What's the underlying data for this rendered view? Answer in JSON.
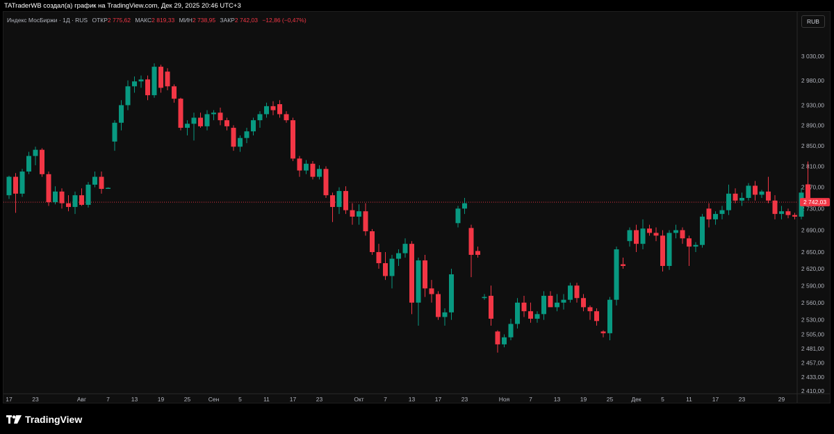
{
  "credit": "TATraderWB создал(а) график на TradingView.com, Дек 29, 2025 20:46 UTC+3",
  "legend": {
    "symbol": "Индекс МосБиржи · 1Д · RUS",
    "open_label": "ОТКР",
    "open": "2 775,62",
    "high_label": "МАКС",
    "high": "2 819,33",
    "low_label": "МИН",
    "low": "2 738,95",
    "close_label": "ЗАКР",
    "close": "2 742,03",
    "change": "−12,86 (−0,47%)"
  },
  "currency_button": "RUB",
  "brand": "TradingView",
  "colors": {
    "up": "#089981",
    "down": "#f23645",
    "background": "#0f0f0f",
    "text": "#d1d4dc"
  },
  "chart_data": {
    "type": "candlestick",
    "y_scale": "log",
    "ylim": [
      2410,
      3060
    ],
    "y_ticks": [
      {
        "value": 3030,
        "label": "3 030,00"
      },
      {
        "value": 2980,
        "label": "2 980,00"
      },
      {
        "value": 2930,
        "label": "2 930,00"
      },
      {
        "value": 2890,
        "label": "2 890,00"
      },
      {
        "value": 2850,
        "label": "2 850,00"
      },
      {
        "value": 2810,
        "label": "2 810,00"
      },
      {
        "value": 2770,
        "label": "2 770,00"
      },
      {
        "value": 2730,
        "label": "2 730,00"
      },
      {
        "value": 2690,
        "label": "2 690,00"
      },
      {
        "value": 2650,
        "label": "2 650,00"
      },
      {
        "value": 2620,
        "label": "2 620,00"
      },
      {
        "value": 2590,
        "label": "2 590,00"
      },
      {
        "value": 2560,
        "label": "2 560,00"
      },
      {
        "value": 2530,
        "label": "2 530,00"
      },
      {
        "value": 2505,
        "label": "2 505,00"
      },
      {
        "value": 2481,
        "label": "2 481,00"
      },
      {
        "value": 2457,
        "label": "2 457,00"
      },
      {
        "value": 2433,
        "label": "2 433,00"
      },
      {
        "value": 2410,
        "label": "2 410,00"
      }
    ],
    "x_ticks": [
      {
        "index": 0,
        "label": "17"
      },
      {
        "index": 4,
        "label": "23"
      },
      {
        "index": 11,
        "label": "Авг"
      },
      {
        "index": 15,
        "label": "7"
      },
      {
        "index": 19,
        "label": "13"
      },
      {
        "index": 23,
        "label": "19"
      },
      {
        "index": 27,
        "label": "25"
      },
      {
        "index": 31,
        "label": "Сен"
      },
      {
        "index": 35,
        "label": "5"
      },
      {
        "index": 39,
        "label": "11"
      },
      {
        "index": 43,
        "label": "17"
      },
      {
        "index": 47,
        "label": "23"
      },
      {
        "index": 53,
        "label": "Окт"
      },
      {
        "index": 57,
        "label": "7"
      },
      {
        "index": 61,
        "label": "13"
      },
      {
        "index": 65,
        "label": "17"
      },
      {
        "index": 69,
        "label": "23"
      },
      {
        "index": 75,
        "label": "Ноя"
      },
      {
        "index": 79,
        "label": "7"
      },
      {
        "index": 83,
        "label": "13"
      },
      {
        "index": 87,
        "label": "19"
      },
      {
        "index": 91,
        "label": "25"
      },
      {
        "index": 95,
        "label": "Дек"
      },
      {
        "index": 99,
        "label": "5"
      },
      {
        "index": 103,
        "label": "11"
      },
      {
        "index": 107,
        "label": "17"
      },
      {
        "index": 111,
        "label": "23"
      },
      {
        "index": 117,
        "label": "29"
      }
    ],
    "last_price": {
      "value": 2742.03,
      "label": "2 742,03"
    },
    "candles": [
      {
        "o": 2755,
        "h": 2792,
        "l": 2748,
        "c": 2790
      },
      {
        "o": 2790,
        "h": 2797,
        "l": 2722,
        "c": 2758
      },
      {
        "o": 2758,
        "h": 2805,
        "l": 2752,
        "c": 2800
      },
      {
        "o": 2800,
        "h": 2838,
        "l": 2795,
        "c": 2830
      },
      {
        "o": 2830,
        "h": 2848,
        "l": 2812,
        "c": 2842
      },
      {
        "o": 2842,
        "h": 2845,
        "l": 2790,
        "c": 2795
      },
      {
        "o": 2795,
        "h": 2800,
        "l": 2735,
        "c": 2742
      },
      {
        "o": 2742,
        "h": 2772,
        "l": 2738,
        "c": 2762
      },
      {
        "o": 2762,
        "h": 2768,
        "l": 2730,
        "c": 2740
      },
      {
        "o": 2740,
        "h": 2755,
        "l": 2725,
        "c": 2733
      },
      {
        "o": 2733,
        "h": 2762,
        "l": 2720,
        "c": 2755
      },
      {
        "o": 2755,
        "h": 2768,
        "l": 2735,
        "c": 2737
      },
      {
        "o": 2737,
        "h": 2780,
        "l": 2732,
        "c": 2775
      },
      {
        "o": 2775,
        "h": 2800,
        "l": 2770,
        "c": 2790
      },
      {
        "o": 2790,
        "h": 2800,
        "l": 2758,
        "c": 2767
      },
      {
        "o": 2767,
        "h": 2770,
        "l": 2767,
        "c": 2769
      },
      {
        "o": 2858,
        "h": 2900,
        "l": 2840,
        "c": 2895
      },
      {
        "o": 2895,
        "h": 2940,
        "l": 2880,
        "c": 2930
      },
      {
        "o": 2930,
        "h": 2980,
        "l": 2920,
        "c": 2968
      },
      {
        "o": 2968,
        "h": 2988,
        "l": 2955,
        "c": 2978
      },
      {
        "o": 2978,
        "h": 2990,
        "l": 2965,
        "c": 2982
      },
      {
        "o": 2982,
        "h": 2990,
        "l": 2940,
        "c": 2950
      },
      {
        "o": 2950,
        "h": 3015,
        "l": 2945,
        "c": 3008
      },
      {
        "o": 3008,
        "h": 3012,
        "l": 2955,
        "c": 2965
      },
      {
        "o": 2998,
        "h": 3005,
        "l": 2960,
        "c": 2968
      },
      {
        "o": 2968,
        "h": 2972,
        "l": 2935,
        "c": 2943
      },
      {
        "o": 2943,
        "h": 2945,
        "l": 2880,
        "c": 2885
      },
      {
        "o": 2885,
        "h": 2900,
        "l": 2870,
        "c": 2893
      },
      {
        "o": 2893,
        "h": 2915,
        "l": 2860,
        "c": 2905
      },
      {
        "o": 2905,
        "h": 2915,
        "l": 2885,
        "c": 2888
      },
      {
        "o": 2888,
        "h": 2920,
        "l": 2880,
        "c": 2912
      },
      {
        "o": 2912,
        "h": 2920,
        "l": 2900,
        "c": 2915
      },
      {
        "o": 2915,
        "h": 2925,
        "l": 2890,
        "c": 2900
      },
      {
        "o": 2900,
        "h": 2905,
        "l": 2880,
        "c": 2888
      },
      {
        "o": 2885,
        "h": 2890,
        "l": 2840,
        "c": 2848
      },
      {
        "o": 2848,
        "h": 2870,
        "l": 2838,
        "c": 2865
      },
      {
        "o": 2865,
        "h": 2885,
        "l": 2855,
        "c": 2878
      },
      {
        "o": 2878,
        "h": 2905,
        "l": 2870,
        "c": 2900
      },
      {
        "o": 2900,
        "h": 2918,
        "l": 2885,
        "c": 2912
      },
      {
        "o": 2912,
        "h": 2935,
        "l": 2905,
        "c": 2928
      },
      {
        "o": 2928,
        "h": 2938,
        "l": 2910,
        "c": 2920
      },
      {
        "o": 2932,
        "h": 2940,
        "l": 2905,
        "c": 2912
      },
      {
        "o": 2912,
        "h": 2918,
        "l": 2895,
        "c": 2900
      },
      {
        "o": 2900,
        "h": 2905,
        "l": 2820,
        "c": 2825
      },
      {
        "o": 2825,
        "h": 2830,
        "l": 2790,
        "c": 2802
      },
      {
        "o": 2802,
        "h": 2822,
        "l": 2795,
        "c": 2815
      },
      {
        "o": 2815,
        "h": 2820,
        "l": 2785,
        "c": 2790
      },
      {
        "o": 2790,
        "h": 2812,
        "l": 2785,
        "c": 2805
      },
      {
        "o": 2805,
        "h": 2810,
        "l": 2750,
        "c": 2755
      },
      {
        "o": 2755,
        "h": 2760,
        "l": 2705,
        "c": 2733
      },
      {
        "o": 2733,
        "h": 2770,
        "l": 2720,
        "c": 2763
      },
      {
        "o": 2763,
        "h": 2772,
        "l": 2720,
        "c": 2727
      },
      {
        "o": 2727,
        "h": 2740,
        "l": 2700,
        "c": 2715
      },
      {
        "o": 2715,
        "h": 2738,
        "l": 2700,
        "c": 2725
      },
      {
        "o": 2725,
        "h": 2740,
        "l": 2680,
        "c": 2688
      },
      {
        "o": 2688,
        "h": 2692,
        "l": 2645,
        "c": 2650
      },
      {
        "o": 2650,
        "h": 2665,
        "l": 2620,
        "c": 2630
      },
      {
        "o": 2630,
        "h": 2650,
        "l": 2600,
        "c": 2607
      },
      {
        "o": 2607,
        "h": 2645,
        "l": 2585,
        "c": 2638
      },
      {
        "o": 2638,
        "h": 2655,
        "l": 2625,
        "c": 2648
      },
      {
        "o": 2648,
        "h": 2675,
        "l": 2640,
        "c": 2665
      },
      {
        "o": 2665,
        "h": 2670,
        "l": 2540,
        "c": 2560
      },
      {
        "o": 2560,
        "h": 2640,
        "l": 2520,
        "c": 2635
      },
      {
        "o": 2635,
        "h": 2645,
        "l": 2570,
        "c": 2585
      },
      {
        "o": 2585,
        "h": 2600,
        "l": 2560,
        "c": 2575
      },
      {
        "o": 2575,
        "h": 2580,
        "l": 2530,
        "c": 2535
      },
      {
        "o": 2535,
        "h": 2550,
        "l": 2520,
        "c": 2543
      },
      {
        "o": 2543,
        "h": 2620,
        "l": 2530,
        "c": 2610
      },
      {
        "o": 2703,
        "h": 2735,
        "l": 2695,
        "c": 2730
      },
      {
        "o": 2730,
        "h": 2750,
        "l": 2720,
        "c": 2740
      },
      {
        "o": 2694,
        "h": 2700,
        "l": 2605,
        "c": 2645
      },
      {
        "o": 2652,
        "h": 2660,
        "l": 2640,
        "c": 2645
      },
      {
        "o": 2568,
        "h": 2575,
        "l": 2565,
        "c": 2570
      },
      {
        "o": 2572,
        "h": 2590,
        "l": 2520,
        "c": 2532
      },
      {
        "o": 2510,
        "h": 2512,
        "l": 2474,
        "c": 2488
      },
      {
        "o": 2488,
        "h": 2505,
        "l": 2483,
        "c": 2500
      },
      {
        "o": 2500,
        "h": 2532,
        "l": 2495,
        "c": 2523
      },
      {
        "o": 2523,
        "h": 2568,
        "l": 2515,
        "c": 2560
      },
      {
        "o": 2560,
        "h": 2572,
        "l": 2535,
        "c": 2545
      },
      {
        "o": 2545,
        "h": 2560,
        "l": 2525,
        "c": 2532
      },
      {
        "o": 2532,
        "h": 2545,
        "l": 2525,
        "c": 2540
      },
      {
        "o": 2540,
        "h": 2580,
        "l": 2530,
        "c": 2572
      },
      {
        "o": 2572,
        "h": 2580,
        "l": 2560,
        "c": 2552
      },
      {
        "o": 2552,
        "h": 2575,
        "l": 2545,
        "c": 2560
      },
      {
        "o": 2560,
        "h": 2575,
        "l": 2548,
        "c": 2565
      },
      {
        "o": 2565,
        "h": 2595,
        "l": 2560,
        "c": 2590
      },
      {
        "o": 2590,
        "h": 2595,
        "l": 2560,
        "c": 2568
      },
      {
        "o": 2568,
        "h": 2575,
        "l": 2545,
        "c": 2552
      },
      {
        "o": 2552,
        "h": 2555,
        "l": 2530,
        "c": 2545
      },
      {
        "o": 2545,
        "h": 2550,
        "l": 2520,
        "c": 2528
      },
      {
        "o": 2510,
        "h": 2512,
        "l": 2500,
        "c": 2507
      },
      {
        "o": 2507,
        "h": 2570,
        "l": 2495,
        "c": 2565
      },
      {
        "o": 2565,
        "h": 2660,
        "l": 2555,
        "c": 2655
      },
      {
        "o": 2628,
        "h": 2640,
        "l": 2620,
        "c": 2625
      },
      {
        "o": 2670,
        "h": 2695,
        "l": 2660,
        "c": 2690
      },
      {
        "o": 2690,
        "h": 2700,
        "l": 2650,
        "c": 2665
      },
      {
        "o": 2665,
        "h": 2710,
        "l": 2655,
        "c": 2693
      },
      {
        "o": 2693,
        "h": 2700,
        "l": 2680,
        "c": 2685
      },
      {
        "o": 2685,
        "h": 2695,
        "l": 2670,
        "c": 2680
      },
      {
        "o": 2680,
        "h": 2690,
        "l": 2615,
        "c": 2625
      },
      {
        "o": 2625,
        "h": 2690,
        "l": 2618,
        "c": 2685
      },
      {
        "o": 2685,
        "h": 2700,
        "l": 2675,
        "c": 2690
      },
      {
        "o": 2690,
        "h": 2695,
        "l": 2665,
        "c": 2675
      },
      {
        "o": 2675,
        "h": 2680,
        "l": 2625,
        "c": 2660
      },
      {
        "o": 2660,
        "h": 2668,
        "l": 2650,
        "c": 2663
      },
      {
        "o": 2663,
        "h": 2720,
        "l": 2658,
        "c": 2715
      },
      {
        "o": 2730,
        "h": 2740,
        "l": 2695,
        "c": 2710
      },
      {
        "o": 2710,
        "h": 2725,
        "l": 2700,
        "c": 2720
      },
      {
        "o": 2720,
        "h": 2735,
        "l": 2710,
        "c": 2727
      },
      {
        "o": 2727,
        "h": 2775,
        "l": 2718,
        "c": 2758
      },
      {
        "o": 2758,
        "h": 2768,
        "l": 2740,
        "c": 2745
      },
      {
        "o": 2745,
        "h": 2760,
        "l": 2735,
        "c": 2750
      },
      {
        "o": 2750,
        "h": 2778,
        "l": 2745,
        "c": 2773
      },
      {
        "o": 2773,
        "h": 2782,
        "l": 2745,
        "c": 2756
      },
      {
        "o": 2756,
        "h": 2765,
        "l": 2750,
        "c": 2762
      },
      {
        "o": 2762,
        "h": 2790,
        "l": 2740,
        "c": 2745
      },
      {
        "o": 2745,
        "h": 2755,
        "l": 2710,
        "c": 2720
      },
      {
        "o": 2720,
        "h": 2735,
        "l": 2710,
        "c": 2725
      },
      {
        "o": 2725,
        "h": 2730,
        "l": 2712,
        "c": 2718
      },
      {
        "o": 2718,
        "h": 2722,
        "l": 2710,
        "c": 2715
      },
      {
        "o": 2715,
        "h": 2768,
        "l": 2710,
        "c": 2760
      },
      {
        "o": 2775.62,
        "h": 2819.33,
        "l": 2738.95,
        "c": 2742.03
      }
    ]
  }
}
